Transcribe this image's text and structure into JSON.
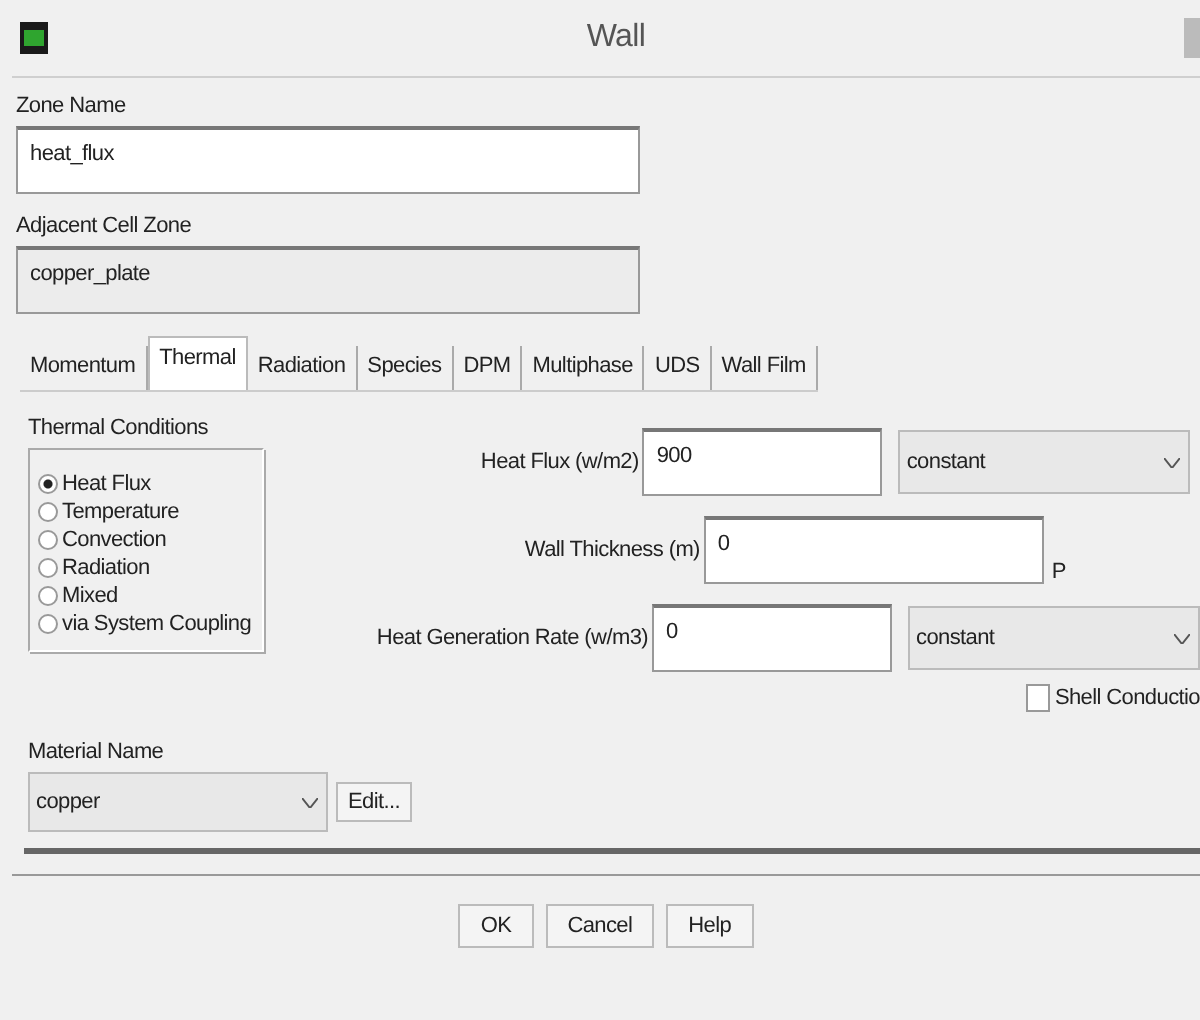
{
  "window": {
    "title": "Wall"
  },
  "zone_name": {
    "label": "Zone Name",
    "value": "heat_flux"
  },
  "adjacent_cell_zone": {
    "label": "Adjacent Cell Zone",
    "value": "copper_plate"
  },
  "tabs": [
    {
      "label": "Momentum",
      "selected": false
    },
    {
      "label": "Thermal",
      "selected": true
    },
    {
      "label": "Radiation",
      "selected": false
    },
    {
      "label": "Species",
      "selected": false
    },
    {
      "label": "DPM",
      "selected": false
    },
    {
      "label": "Multiphase",
      "selected": false
    },
    {
      "label": "UDS",
      "selected": false
    },
    {
      "label": "Wall Film",
      "selected": false
    }
  ],
  "thermal_conditions": {
    "label": "Thermal Conditions",
    "options": [
      {
        "label": "Heat Flux",
        "selected": true
      },
      {
        "label": "Temperature",
        "selected": false
      },
      {
        "label": "Convection",
        "selected": false
      },
      {
        "label": "Radiation",
        "selected": false
      },
      {
        "label": "Mixed",
        "selected": false
      },
      {
        "label": "via System Coupling",
        "selected": false
      }
    ]
  },
  "heat_flux": {
    "label": "Heat Flux (w/m2)",
    "value": "900",
    "method": "constant"
  },
  "wall_thickness": {
    "label": "Wall Thickness (m)",
    "value": "0",
    "unit_cut": "P"
  },
  "heat_generation_rate": {
    "label": "Heat Generation Rate (w/m3)",
    "value": "0",
    "method": "constant"
  },
  "shell_conduction": {
    "label": "Shell Conductio",
    "checked": false
  },
  "material_name": {
    "label": "Material Name",
    "value": "copper",
    "edit_button": "Edit..."
  },
  "buttons": [
    "OK",
    "Cancel",
    "Help"
  ]
}
